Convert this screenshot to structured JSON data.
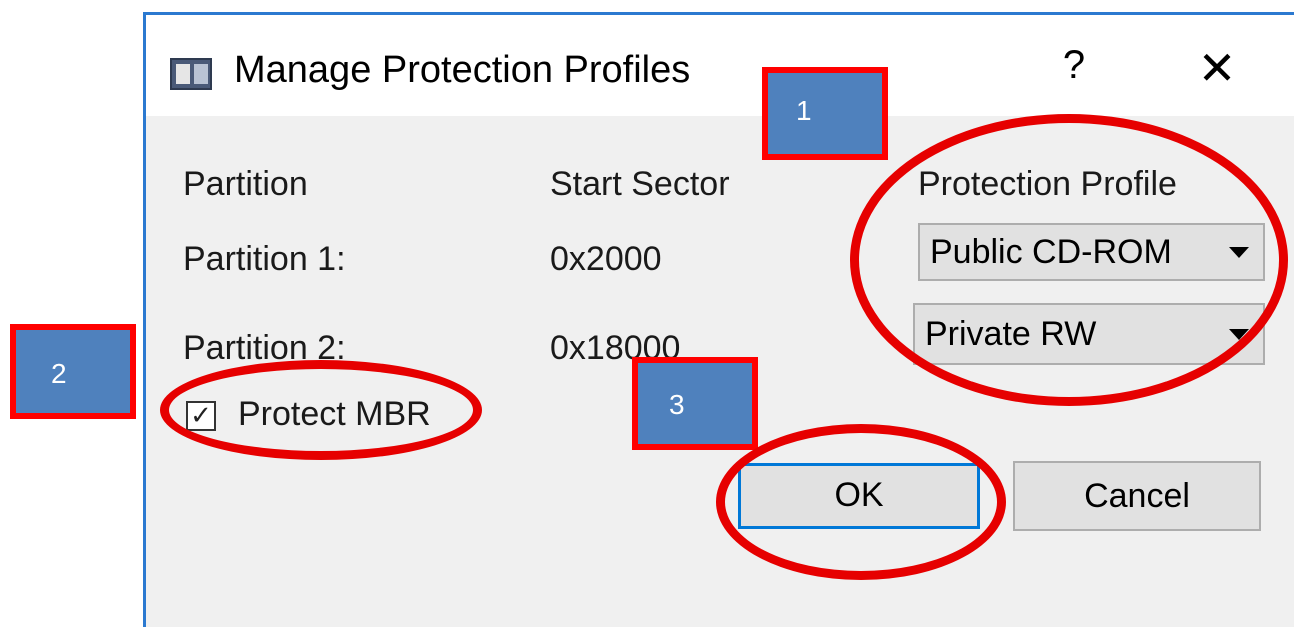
{
  "window": {
    "title": "Manage Protection Profiles",
    "help_glyph": "?",
    "close_glyph": "✕"
  },
  "table": {
    "headers": [
      "Partition",
      "Start Sector",
      "Protection Profile"
    ],
    "rows": [
      {
        "partition": "Partition 1:",
        "start_sector": "0x2000",
        "profile": "Public CD-ROM"
      },
      {
        "partition": "Partition 2:",
        "start_sector": "0x18000",
        "profile": "Private RW"
      }
    ]
  },
  "checkbox": {
    "label": "Protect MBR",
    "checked": true,
    "glyph": "✓"
  },
  "buttons": {
    "ok": "OK",
    "cancel": "Cancel"
  },
  "annotations": {
    "markers": [
      "1",
      "2",
      "3"
    ],
    "highlight_color": "#ff0000",
    "marker_fill": "#4f81bd"
  },
  "colors": {
    "focus_border": "#0078d7",
    "window_border": "#2b79d0",
    "dialog_background": "#f0f0f0"
  }
}
